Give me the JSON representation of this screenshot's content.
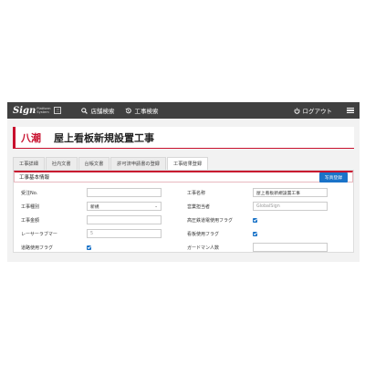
{
  "header": {
    "logo_main": "Sign",
    "logo_sub1": "Platform",
    "logo_sub2": "System",
    "logo_box": "三",
    "nav": [
      {
        "label": "店舗検索",
        "icon": "search-icon"
      },
      {
        "label": "工事検索",
        "icon": "history-icon"
      }
    ],
    "logout_label": "ログアウト",
    "colors": {
      "bar": "#404040",
      "accent": "#c8102e",
      "primary": "#1a73c8"
    }
  },
  "page": {
    "store_name": "八潮",
    "work_title": "屋上看板新規設置工事"
  },
  "tabs": [
    {
      "label": "工事詳細",
      "active": false
    },
    {
      "label": "社内文書",
      "active": false
    },
    {
      "label": "台帳文書",
      "active": false
    },
    {
      "label": "許可済申請書の登録",
      "active": false
    },
    {
      "label": "工事結果登録",
      "active": true
    }
  ],
  "panel": {
    "title": "工事基本情報",
    "photo_button": "写真登録"
  },
  "form": {
    "left": [
      {
        "label": "受注No.",
        "type": "input",
        "value": ""
      },
      {
        "label": "工事種別",
        "type": "select",
        "value": "新規"
      },
      {
        "label": "工事金額",
        "type": "input",
        "value": ""
      },
      {
        "label": "レーサーラブマー",
        "type": "input",
        "value": "",
        "placeholder": "5"
      },
      {
        "label": "道路使用フラグ",
        "type": "checkbox",
        "checked": true
      }
    ],
    "right": [
      {
        "label": "工事名称",
        "type": "input",
        "value": "屋上看板新規設置工事"
      },
      {
        "label": "営業担当者",
        "type": "input",
        "value": "",
        "placeholder": "GlobalSign"
      },
      {
        "label": "高圧鉄道電使用フラグ",
        "type": "checkbox",
        "checked": true
      },
      {
        "label": "看板使用フラグ",
        "type": "checkbox",
        "checked": true
      },
      {
        "label": "ガードマン人数",
        "type": "input",
        "value": ""
      }
    ]
  }
}
